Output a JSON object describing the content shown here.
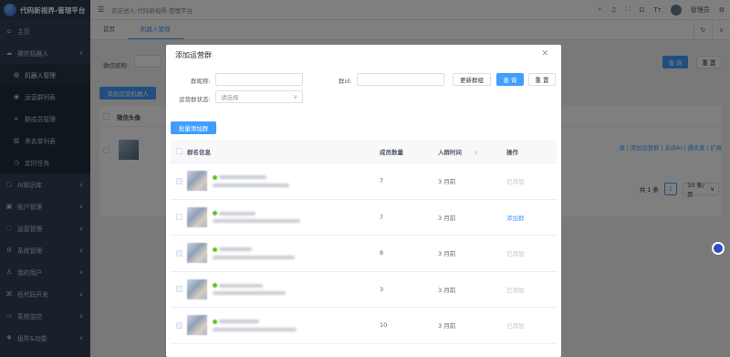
{
  "app": {
    "title": "代码新视界-管理平台"
  },
  "sidebar": {
    "items": [
      {
        "label": "主页",
        "icon": "home-icon"
      },
      {
        "label": "微信机器人",
        "icon": "wechat-icon"
      }
    ],
    "sub_items": [
      {
        "label": "机器人管理",
        "icon": "robot-icon"
      },
      {
        "label": "运营群列表",
        "icon": "chat-icon"
      },
      {
        "label": "群成员管理",
        "icon": "user-group-icon"
      },
      {
        "label": "黑名单列表",
        "icon": "blacklist-icon"
      },
      {
        "label": "定时任务",
        "icon": "clock-icon"
      }
    ],
    "more_items": [
      {
        "label": "AI知识库",
        "icon": "ai-icon"
      },
      {
        "label": "账户管理",
        "icon": "account-icon"
      },
      {
        "label": "运营管理",
        "icon": "operation-icon"
      },
      {
        "label": "系统管理",
        "icon": "settings-icon"
      },
      {
        "label": "我的用户",
        "icon": "user-icon"
      },
      {
        "label": "低代码开发",
        "icon": "code-icon"
      },
      {
        "label": "系统监控",
        "icon": "monitor-icon"
      },
      {
        "label": "组件&功能",
        "icon": "component-icon"
      }
    ]
  },
  "topbar": {
    "breadcrumb": "欢迎进入·代码新视界-管理平台",
    "username": "管理员"
  },
  "tabs": [
    {
      "label": "首页"
    },
    {
      "label": "机器人管理"
    }
  ],
  "page": {
    "search_label": "微信昵称:",
    "search_button": "查 询",
    "reset_button": "重 置",
    "add_button": "添加运营机器人",
    "col_avatar": "微信头像",
    "row_links": "录 | 添加运营群 | 关闭AI | 通讯录 | 扩展",
    "pagination": {
      "total": "共 1 条",
      "page": "1",
      "page_size": "10 条/页"
    }
  },
  "dialog": {
    "title": "添加运营群",
    "form": {
      "group_name_label": "群昵称:",
      "group_id_label": "群id:",
      "status_label": "运营群状态:",
      "status_placeholder": "请选择",
      "update_button": "更新群组",
      "query_button": "查 询",
      "reset_button": "重 置"
    },
    "batch_button": "批量添加群",
    "table": {
      "headers": {
        "info": "群名信息",
        "count": "成员数量",
        "time": "入群时间",
        "action": "操作"
      },
      "rows": [
        {
          "count": "7",
          "time": "3 月前",
          "action": "已添加",
          "added": true
        },
        {
          "count": "7",
          "time": "3 月前",
          "action": "添加群",
          "added": false
        },
        {
          "count": "8",
          "time": "3 月前",
          "action": "已添加",
          "added": true
        },
        {
          "count": "3",
          "time": "3 月前",
          "action": "已添加",
          "added": true
        },
        {
          "count": "10",
          "time": "3 月前",
          "action": "已添加",
          "added": true
        }
      ]
    }
  },
  "colors": {
    "primary": "#409eff",
    "sidebar": "#304156",
    "disabled_text": "#c0c4cc"
  }
}
